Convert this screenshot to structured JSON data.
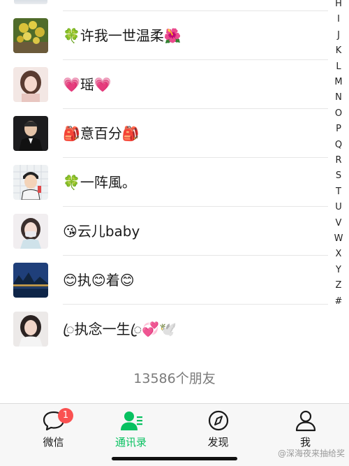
{
  "index": {
    "letters": [
      "H",
      "I",
      "J",
      "K",
      "L",
      "M",
      "N",
      "O",
      "P",
      "Q",
      "R",
      "S",
      "T",
      "U",
      "V",
      "W",
      "X",
      "Y",
      "Z",
      "#"
    ]
  },
  "contacts": [
    {
      "name": "🍀许我一世温柔🌺",
      "avatar": "avatar-flowers"
    },
    {
      "name": "💗瑶💗",
      "avatar": "avatar-girl-portrait"
    },
    {
      "name": "🎒意百分🎒",
      "avatar": "avatar-man-suit"
    },
    {
      "name": "🍀一阵風。",
      "avatar": "avatar-cartoon-boy"
    },
    {
      "name": "😘云儿baby",
      "avatar": "avatar-girl-mask"
    },
    {
      "name": "😊执😊着😊",
      "avatar": "avatar-night-landscape"
    },
    {
      "name": "ꦿ执念一生ꦿ💞🕊️",
      "avatar": "avatar-woman-selfie"
    }
  ],
  "footer": {
    "count_text": "13586个朋友"
  },
  "tabs": [
    {
      "label": "微信",
      "icon": "chat-bubble-icon",
      "badge": "1",
      "active": false
    },
    {
      "label": "通讯录",
      "icon": "contacts-icon",
      "active": true
    },
    {
      "label": "发现",
      "icon": "compass-icon",
      "active": false
    },
    {
      "label": "我",
      "icon": "person-icon",
      "active": false
    }
  ],
  "colors": {
    "accent": "#07c160",
    "badge": "#fa5151",
    "tabbar": "#f7f7f7"
  },
  "watermark": "@深海夜来抽给奖"
}
